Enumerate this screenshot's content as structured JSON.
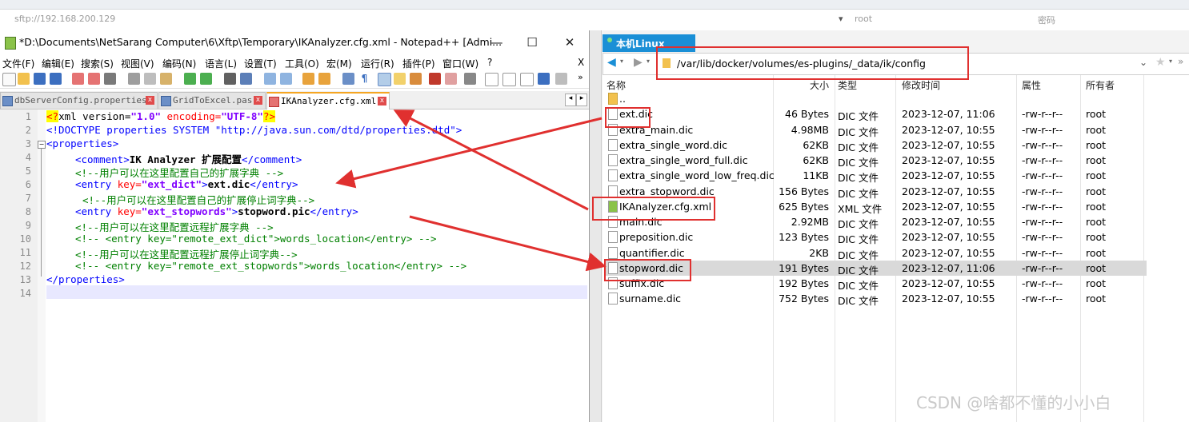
{
  "background": {
    "address": "sftp://192.168.200.129",
    "user": "root",
    "password_label": "密码"
  },
  "npp": {
    "title": "*D:\\Documents\\NetSarang Computer\\6\\Xftp\\Temporary\\IKAnalyzer.cfg.xml - Notepad++ [Admi...",
    "menu": [
      "文件(F)",
      "编辑(E)",
      "搜索(S)",
      "视图(V)",
      "编码(N)",
      "语言(L)",
      "设置(T)",
      "工具(O)",
      "宏(M)",
      "运行(R)",
      "插件(P)",
      "窗口(W)",
      "?"
    ],
    "menu_close": "X",
    "tabs": [
      "dbServerConfig.properties",
      "GridToExcel.pas",
      "IKAnalyzer.cfg.xml"
    ],
    "line_numbers": [
      "1",
      "2",
      "3",
      "4",
      "5",
      "6",
      "7",
      "8",
      "9",
      "10",
      "11",
      "12",
      "13",
      "14"
    ],
    "code": {
      "l1a": "<?",
      "l1b": "xml version=",
      "l1c": "\"1.0\"",
      "l1d": " encoding=",
      "l1e": "\"UTF-8\"",
      "l1f": "?>",
      "l2": "<!DOCTYPE properties SYSTEM \"http://java.sun.com/dtd/properties.dtd\">",
      "l3": "<properties>",
      "l4a": "<comment>",
      "l4b": "IK Analyzer 扩展配置",
      "l4c": "</comment>",
      "l5": "<!--用户可以在这里配置自己的扩展字典 -->",
      "l6a": "<entry ",
      "l6b": "key=",
      "l6c": "\"ext_dict\"",
      "l6d": ">",
      "l6e": "ext.dic",
      "l6f": "</entry>",
      "l7": "<!--用户可以在这里配置自己的扩展停止词字典-->",
      "l8a": "<entry ",
      "l8b": "key=",
      "l8c": "\"ext_stopwords\"",
      "l8d": ">",
      "l8e": "stopword.pic",
      "l8f": "</entry>",
      "l9": "<!--用户可以在这里配置远程扩展字典 -->",
      "l10": "<!-- <entry key=\"remote_ext_dict\">words_location</entry> -->",
      "l11": "<!--用户可以在这里配置远程扩展停止词字典-->",
      "l12": "<!-- <entry key=\"remote_ext_stopwords\">words_location</entry> -->",
      "l13": "</properties>"
    }
  },
  "xftp": {
    "tab_label": "本机Linux",
    "path": "/var/lib/docker/volumes/es-plugins/_data/ik/config",
    "columns": [
      "名称",
      "大小",
      "类型",
      "修改时间",
      "属性",
      "所有者"
    ],
    "files": [
      {
        "name": "..",
        "size": "",
        "type": "",
        "mtime": "",
        "perm": "",
        "owner": ""
      },
      {
        "name": "ext.dic",
        "size": "46 Bytes",
        "type": "DIC 文件",
        "mtime": "2023-12-07, 11:06",
        "perm": "-rw-r--r--",
        "owner": "root"
      },
      {
        "name": "extra_main.dic",
        "size": "4.98MB",
        "type": "DIC 文件",
        "mtime": "2023-12-07, 10:55",
        "perm": "-rw-r--r--",
        "owner": "root"
      },
      {
        "name": "extra_single_word.dic",
        "size": "62KB",
        "type": "DIC 文件",
        "mtime": "2023-12-07, 10:55",
        "perm": "-rw-r--r--",
        "owner": "root"
      },
      {
        "name": "extra_single_word_full.dic",
        "size": "62KB",
        "type": "DIC 文件",
        "mtime": "2023-12-07, 10:55",
        "perm": "-rw-r--r--",
        "owner": "root"
      },
      {
        "name": "extra_single_word_low_freq.dic",
        "size": "11KB",
        "type": "DIC 文件",
        "mtime": "2023-12-07, 10:55",
        "perm": "-rw-r--r--",
        "owner": "root"
      },
      {
        "name": "extra_stopword.dic",
        "size": "156 Bytes",
        "type": "DIC 文件",
        "mtime": "2023-12-07, 10:55",
        "perm": "-rw-r--r--",
        "owner": "root"
      },
      {
        "name": "IKAnalyzer.cfg.xml",
        "size": "625 Bytes",
        "type": "XML 文件",
        "mtime": "2023-12-07, 10:55",
        "perm": "-rw-r--r--",
        "owner": "root"
      },
      {
        "name": "main.dic",
        "size": "2.92MB",
        "type": "DIC 文件",
        "mtime": "2023-12-07, 10:55",
        "perm": "-rw-r--r--",
        "owner": "root"
      },
      {
        "name": "preposition.dic",
        "size": "123 Bytes",
        "type": "DIC 文件",
        "mtime": "2023-12-07, 10:55",
        "perm": "-rw-r--r--",
        "owner": "root"
      },
      {
        "name": "quantifier.dic",
        "size": "2KB",
        "type": "DIC 文件",
        "mtime": "2023-12-07, 10:55",
        "perm": "-rw-r--r--",
        "owner": "root"
      },
      {
        "name": "stopword.dic",
        "size": "191 Bytes",
        "type": "DIC 文件",
        "mtime": "2023-12-07, 11:06",
        "perm": "-rw-r--r--",
        "owner": "root"
      },
      {
        "name": "suffix.dic",
        "size": "192 Bytes",
        "type": "DIC 文件",
        "mtime": "2023-12-07, 10:55",
        "perm": "-rw-r--r--",
        "owner": "root"
      },
      {
        "name": "surname.dic",
        "size": "752 Bytes",
        "type": "DIC 文件",
        "mtime": "2023-12-07, 10:55",
        "perm": "-rw-r--r--",
        "owner": "root"
      }
    ]
  },
  "watermark": "CSDN @啥都不懂的小小白",
  "colors": {
    "annotation": "#e0302f",
    "xftp_tab": "#1a8fd6",
    "selected_row": "#d9d9d9"
  }
}
